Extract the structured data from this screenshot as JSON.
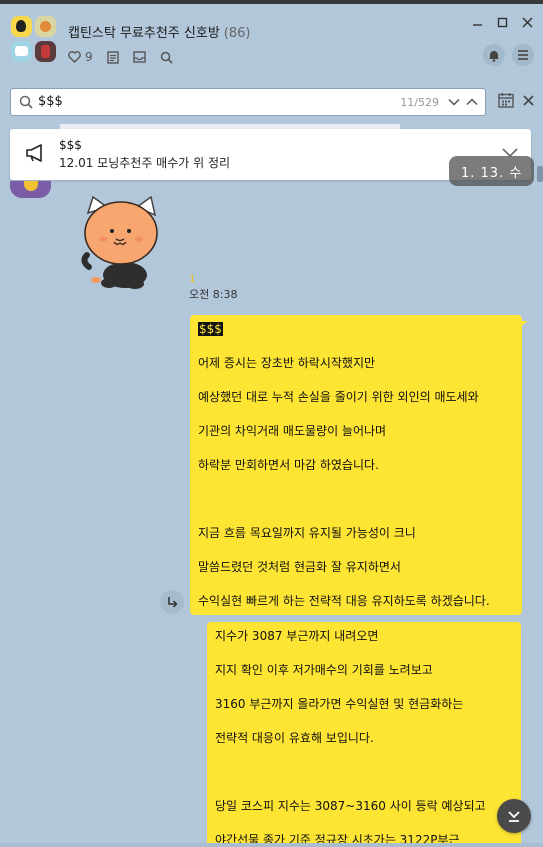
{
  "header": {
    "room_title": "캡틴스탁 무료추천주 신호방",
    "member_count": "(86)",
    "like_count": "9",
    "icons": [
      "heart-icon",
      "notes-icon",
      "inbox-icon",
      "search-icon",
      "bell-icon",
      "menu-icon"
    ]
  },
  "window": {
    "controls": [
      "minimize-icon",
      "maximize-icon",
      "close-icon"
    ]
  },
  "search": {
    "query": "$$$",
    "result_counter": "11/529"
  },
  "notice": {
    "title": "$$$",
    "text": "12.01 모닝추천주 매수가 위 정리"
  },
  "date_pill": "1. 13. 수",
  "message": {
    "read_count": "1",
    "time": "오전 8:38",
    "bubble1": {
      "highlight": "$$$",
      "lines": [
        "어제 증시는 장초반 하락시작했지만",
        "예상했던 대로 누적 손실을 줄이기 위한 외인의 매도세와",
        "기관의 차익거래 매도물량이 늘어나며",
        "하락분 만회하면서 마감 하였습니다.",
        "",
        "지금 흐름 목요일까지 유지될 가능성이 크니",
        "말씀드렸던 것처럼 현금화 잘 유지하면서",
        "수익실현 빠르게 하는 전략적 대응 유지하도록 하겠습니다."
      ]
    },
    "bubble2": {
      "lines": [
        "지수가 3087 부근까지 내려오면",
        "지지 확인 이후 저가매수의 기회를 노려보고",
        "3160 부근까지 올라가면 수익실현 및 현금화하는",
        "전략적 대응이 유효해 보입니다.",
        "",
        "당일 코스피 지수는 3087~3160 사이 등락 예상되고",
        "야간선물 종가 기준 정규장 시초가는 3122P부근"
      ]
    }
  },
  "colors": {
    "chat_bg": "#b2c7da",
    "my_bubble": "#fee533",
    "highlight_bg": "#111111"
  }
}
